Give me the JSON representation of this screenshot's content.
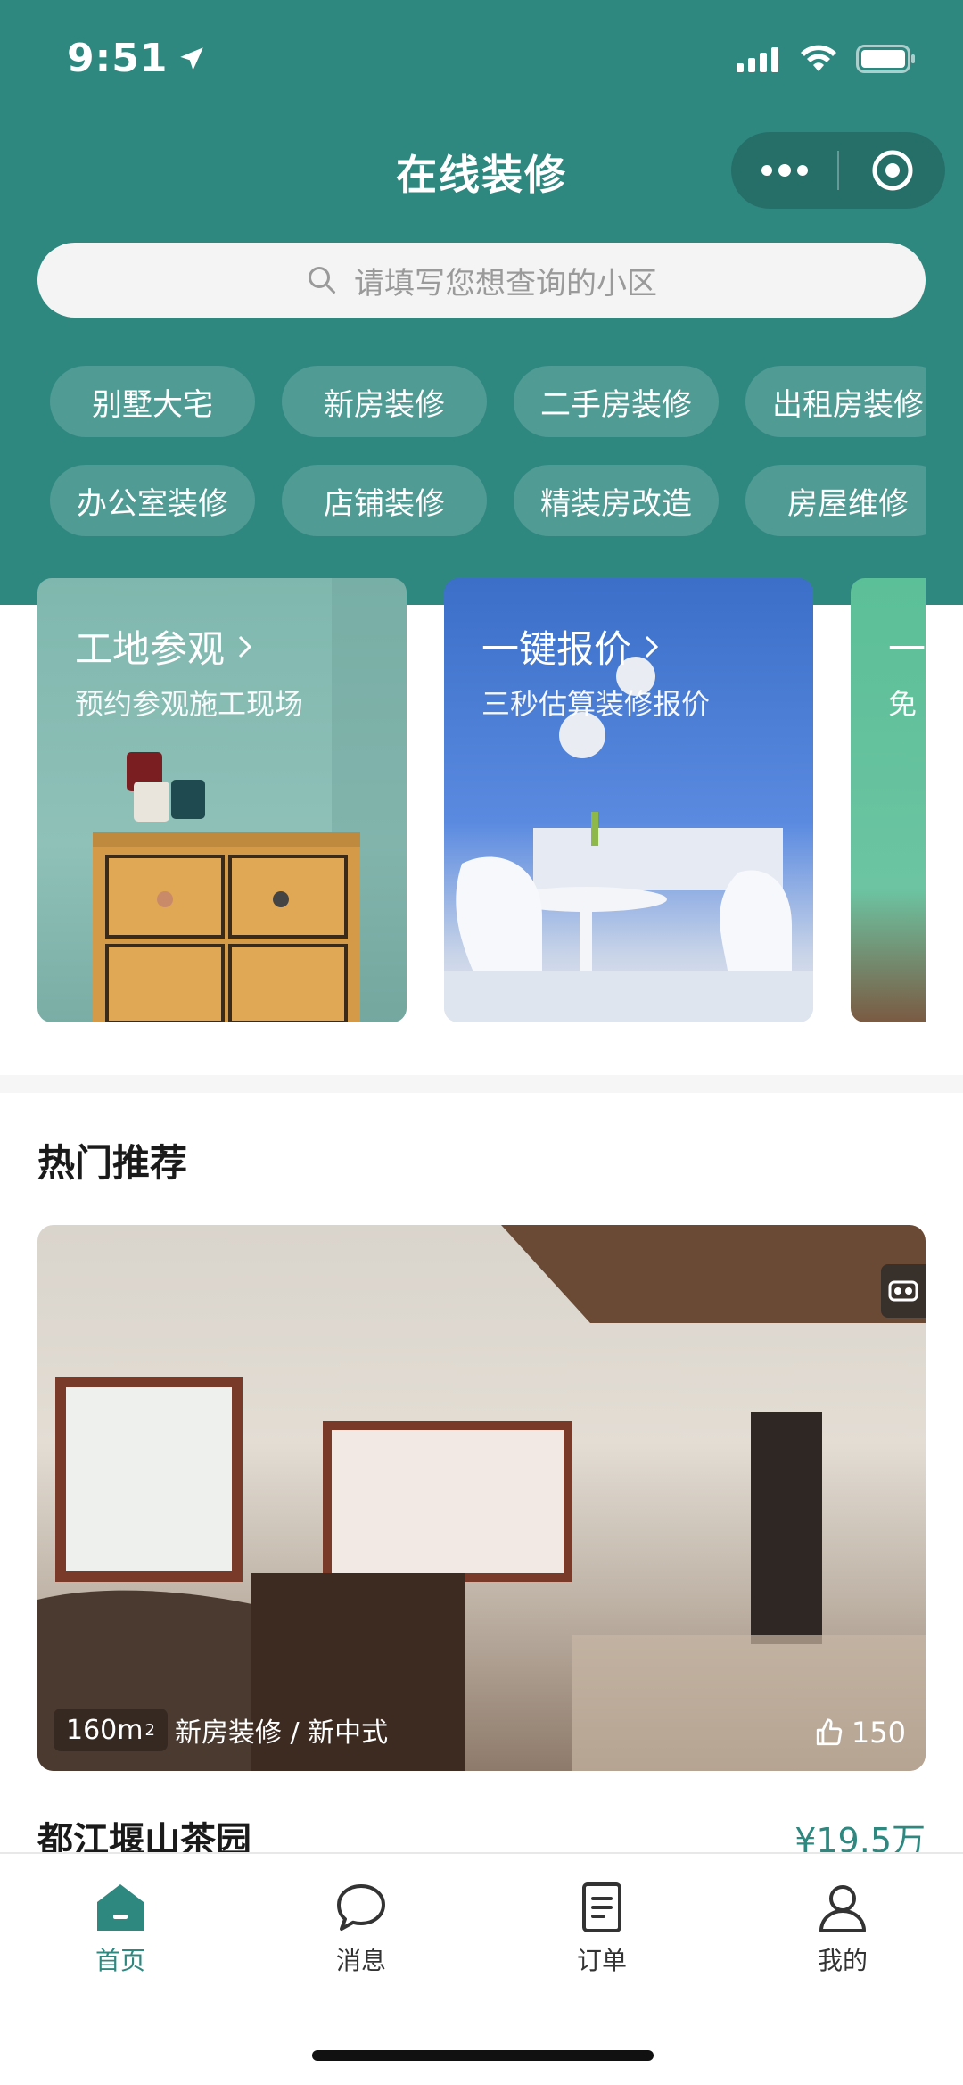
{
  "status_bar": {
    "time": "9:51"
  },
  "app": {
    "title": "在线装修"
  },
  "search": {
    "placeholder": "请填写您想查询的小区"
  },
  "categories_row1": [
    "别墅大宅",
    "新房装修",
    "二手房装修",
    "出租房装修"
  ],
  "categories_row2": [
    "办公室装修",
    "店铺装修",
    "精装房改造",
    "房屋维修"
  ],
  "promo_cards": [
    {
      "title": "工地参观",
      "subtitle": "预约参观施工现场"
    },
    {
      "title": "一键报价",
      "subtitle": "三秒估算装修报价"
    },
    {
      "title": "一",
      "subtitle": "免"
    }
  ],
  "section": {
    "title": "热门推荐"
  },
  "featured": {
    "area": "160m",
    "area_sup": "2",
    "tags": "新房装修 / 新中式",
    "likes": "150",
    "name": "都江堰山茶园",
    "price": "¥19.5万"
  },
  "tabbar": [
    {
      "label": "首页",
      "icon": "home-icon",
      "active": true
    },
    {
      "label": "消息",
      "icon": "message-icon",
      "active": false
    },
    {
      "label": "订单",
      "icon": "order-icon",
      "active": false
    },
    {
      "label": "我的",
      "icon": "profile-icon",
      "active": false
    }
  ],
  "colors": {
    "brand": "#2f8880",
    "text": "#1a1a1a",
    "muted": "#9a9a9a"
  }
}
